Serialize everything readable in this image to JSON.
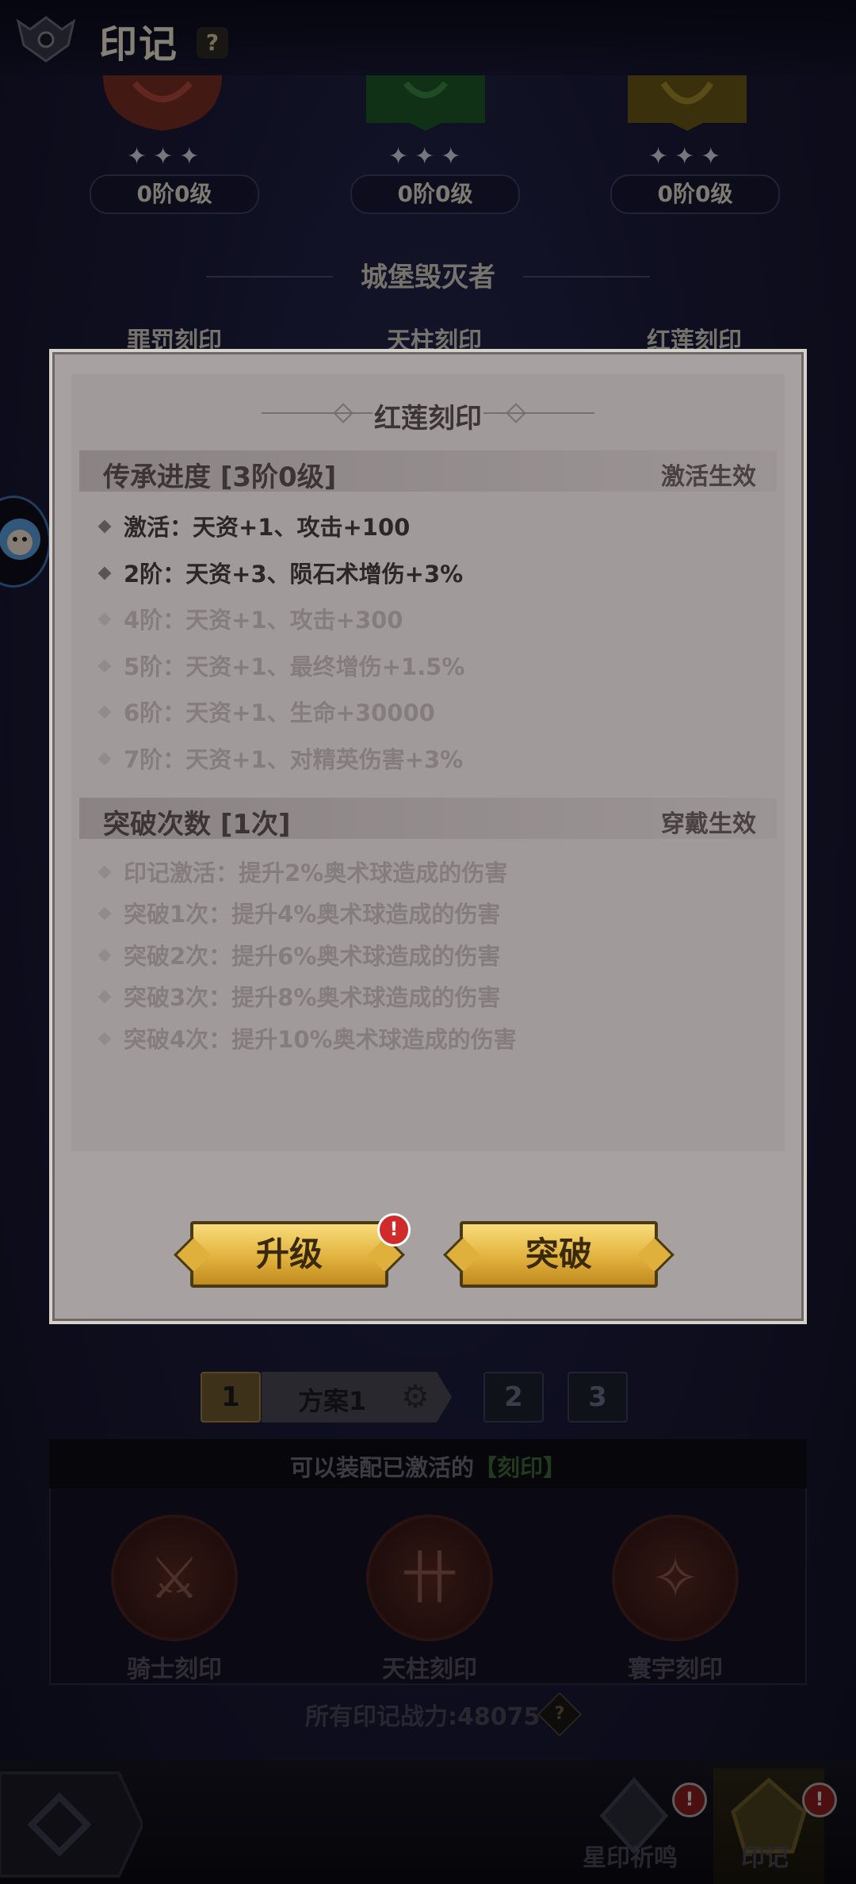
{
  "header": {
    "title": "印记",
    "help_icon": "?"
  },
  "top_slots": [
    {
      "icon": "red-seal-emblem",
      "level": "0阶0级"
    },
    {
      "icon": "green-seal-emblem",
      "level": "0阶0级"
    },
    {
      "icon": "gold-seal-emblem",
      "level": "0阶0级"
    }
  ],
  "stars_glyph": "✦✦✦",
  "set": {
    "title": "城堡毁灭者",
    "slots": [
      "罪罚刻印",
      "天柱刻印",
      "红莲刻印"
    ]
  },
  "dialog": {
    "title": "红莲刻印",
    "inherit": {
      "title": "传承进度 [3阶0级]",
      "status": "激活生效",
      "rows": [
        {
          "text": "激活：天资+1、攻击+100",
          "active": true
        },
        {
          "text": "2阶：天资+3、陨石术增伤+3%",
          "active": true
        },
        {
          "text": "4阶：天资+1、攻击+300",
          "active": false
        },
        {
          "text": "5阶：天资+1、最终增伤+1.5%",
          "active": false
        },
        {
          "text": "6阶：天资+1、生命+30000",
          "active": false
        },
        {
          "text": "7阶：天资+1、对精英伤害+3%",
          "active": false
        }
      ]
    },
    "breakthrough": {
      "title": "突破次数 [1次]",
      "status": "穿戴生效",
      "rows": [
        {
          "text": "印记激活：提升2%奥术球造成的伤害",
          "active": false
        },
        {
          "text": "突破1次：提升4%奥术球造成的伤害",
          "active": false
        },
        {
          "text": "突破2次：提升6%奥术球造成的伤害",
          "active": false
        },
        {
          "text": "突破3次：提升8%奥术球造成的伤害",
          "active": false
        },
        {
          "text": "突破4次：提升10%奥术球造成的伤害",
          "active": false
        }
      ]
    },
    "upgrade_label": "升级",
    "breakthrough_label": "突破",
    "upgrade_badge": "!"
  },
  "scheme": {
    "tabs": [
      "1",
      "2",
      "3"
    ],
    "name": "方案1",
    "gear_icon": "⚙"
  },
  "equip": {
    "prefix": "可以装配已激活的",
    "highlight": "【刻印】",
    "seals": [
      {
        "label": "骑士刻印",
        "icon": "knight-seal-icon",
        "glyph": "⚔"
      },
      {
        "label": "天柱刻印",
        "icon": "pillar-seal-icon",
        "glyph": "卄"
      },
      {
        "label": "寰宇刻印",
        "icon": "cosmos-seal-icon",
        "glyph": "✧"
      }
    ]
  },
  "power": {
    "text": "所有印记战力:48075",
    "help": "?"
  },
  "nav": {
    "items": [
      {
        "label": "星印祈鸣",
        "badge": "!"
      },
      {
        "label": "印记",
        "badge": "!"
      }
    ]
  },
  "colors": {
    "accent_gold": "#e2b23e",
    "badge_red": "#d12a2a",
    "highlight_green": "#3d6a3a",
    "parchment": "#a8a1a1"
  }
}
